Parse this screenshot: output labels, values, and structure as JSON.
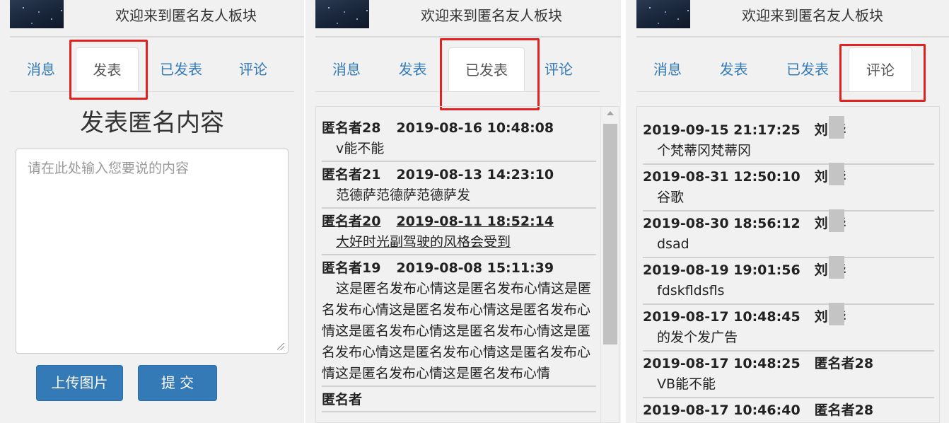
{
  "panels": [
    {
      "header_title": "欢迎来到匿名友人板块",
      "tabs": [
        "消息",
        "发表",
        "已发表",
        "评论"
      ],
      "active_tab": "发表",
      "compose": {
        "heading": "发表匿名内容",
        "placeholder": "请在此处输入您要说的内容",
        "value": "",
        "upload_label": "上传图片",
        "submit_label": "提 交"
      }
    },
    {
      "header_title": "欢迎来到匿名友人板块",
      "tabs": [
        "消息",
        "发表",
        "已发表",
        "评论"
      ],
      "active_tab": "已发表",
      "posts": [
        {
          "author": "匿名者28",
          "time": "2019-08-16 10:48:08",
          "content": "v能不能"
        },
        {
          "author": "匿名者21",
          "time": "2019-08-13 14:23:10",
          "content": "范德萨范德萨范德萨发"
        },
        {
          "author": "匿名者20",
          "time": "2019-08-11 18:52:14",
          "content": "大好时光副驾驶的风格会受到"
        },
        {
          "author": "匿名者19",
          "time": "2019-08-08 15:11:39",
          "content": "这是匿名发布心情这是匿名发布心情这是匿名发布心情这是匿名发布心情这是匿名发布心情这是匿名发布心情这是匿名发布心情这是匿名发布心情这是匿名发布心情这是匿名发布心情这是匿名发布心情这是匿名发布心情"
        },
        {
          "author": "匿名者",
          "time": "",
          "content": ""
        }
      ]
    },
    {
      "header_title": "欢迎来到匿名友人板块",
      "tabs": [
        "消息",
        "发表",
        "已发表",
        "评论"
      ],
      "active_tab": "评论",
      "comments": [
        {
          "time": "2019-09-15 21:17:25",
          "name": "刘  华",
          "masked": true,
          "content": "个梵蒂冈梵蒂冈"
        },
        {
          "time": "2019-08-31 12:50:10",
          "name": "刘  华",
          "masked": true,
          "content": "谷歌"
        },
        {
          "time": "2019-08-30 18:56:12",
          "name": "刘  华",
          "masked": true,
          "content": "dsad"
        },
        {
          "time": "2019-08-19 19:01:56",
          "name": "刘  华",
          "masked": true,
          "content": "fdskfldsfls"
        },
        {
          "time": "2019-08-17 10:48:45",
          "name": "刘  华",
          "masked": true,
          "content": "的发个发广告"
        },
        {
          "time": "2019-08-17 10:48:25",
          "name": "匿名者28",
          "masked": false,
          "content": "VB能不能"
        },
        {
          "time": "2019-08-17 10:46:40",
          "name": "匿名者28",
          "masked": false,
          "content": ""
        }
      ]
    }
  ],
  "colors": {
    "highlight": "#e3211f",
    "link": "#337ab7",
    "button": "#337ab7"
  }
}
